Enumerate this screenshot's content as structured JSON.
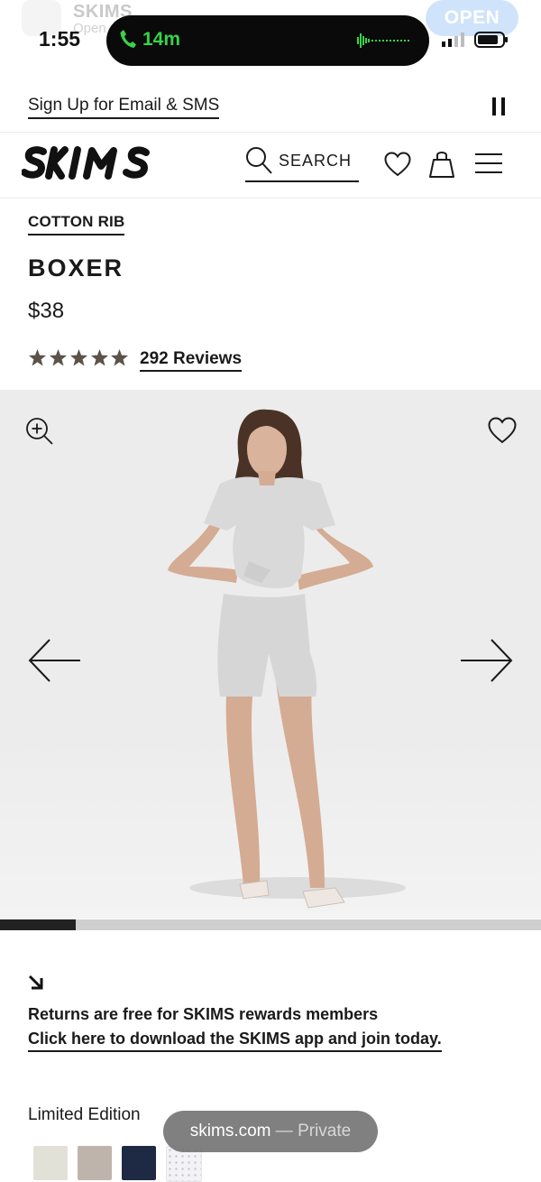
{
  "status_bar": {
    "time": "1:55",
    "call_duration": "14m",
    "app_banner": {
      "name": "SKIMS",
      "subtitle": "Open",
      "button": "OPEN"
    }
  },
  "banner": {
    "email_signup": "Sign Up for Email & SMS"
  },
  "header": {
    "logo_alt": "SKIMS",
    "search_label": "SEARCH"
  },
  "product": {
    "collection": "COTTON RIB",
    "name": "BOXER",
    "price": "$38",
    "rating": 5,
    "reviews": "292 Reviews"
  },
  "gallery": {
    "progress": 0.14
  },
  "promo": {
    "text": "Returns are free for SKIMS rewards members",
    "link": "Click here to download the SKIMS app and join today."
  },
  "variants": {
    "label": "Limited Edition",
    "swatches": [
      {
        "name": "swatch-bone",
        "color": "#e2e1d8"
      },
      {
        "name": "swatch-taupe",
        "color": "#bfb4ab"
      },
      {
        "name": "swatch-navy",
        "color": "#1e2a44"
      },
      {
        "name": "swatch-print",
        "color": "#f3f3f6"
      }
    ]
  },
  "url_bar": {
    "domain": "skims.com",
    "separator": " — ",
    "mode": "Private"
  },
  "colors": {
    "ink": "#1a1a1a",
    "star": "#5b5348",
    "call_green": "#38d24a",
    "gallery_bg": "#ececec"
  }
}
